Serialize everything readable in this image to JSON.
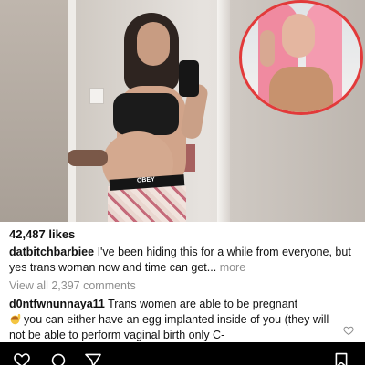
{
  "post": {
    "likes": "42,487 likes",
    "caption_user": "datbitchbarbiee",
    "caption_text": "I've been hiding this for a while from everyone, but yes trans woman now and time can get...",
    "more_label": "more",
    "view_comments": "View all 2,397 comments",
    "waistband_text": "OBEY",
    "comment": {
      "user": "d0ntfwnunnaya11",
      "text_line1": "Trans women are able to be pregnant",
      "text_rest": "you can either have an egg implanted inside of you (they will not be able to perform vaginal birth only C-",
      "emoji": "woman-raising-hand-emoji"
    }
  },
  "icons": {
    "comment_like": "heart-outline-icon",
    "bar": [
      "heart-icon",
      "comment-icon",
      "share-icon",
      "bookmark-icon"
    ]
  },
  "colors": {
    "inset_border": "#e23a3a",
    "muted_text": "#8e8e8e",
    "bar_bg": "#000000"
  }
}
